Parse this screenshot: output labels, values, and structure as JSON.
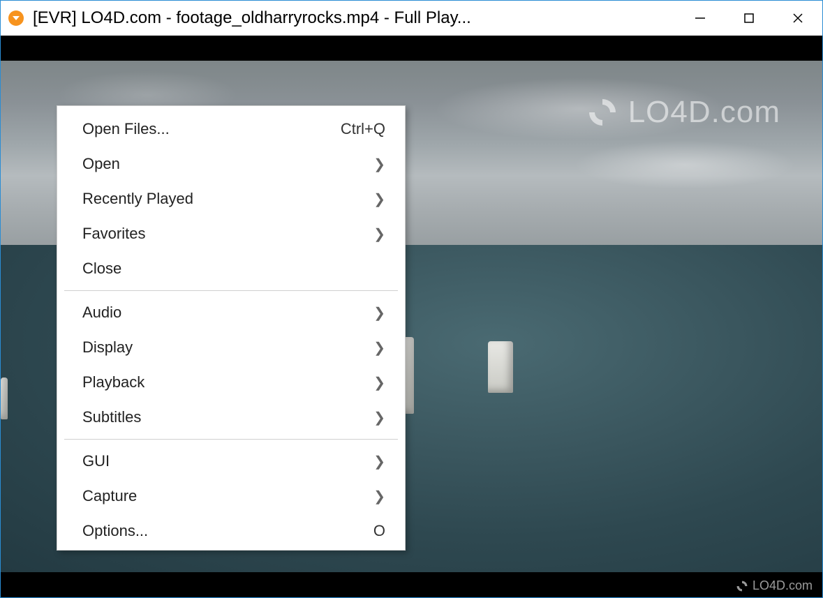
{
  "titlebar": {
    "title": "[EVR] LO4D.com - footage_oldharryrocks.mp4 - Full Play..."
  },
  "menu": {
    "items": [
      {
        "label": "Open Files...",
        "shortcut": "Ctrl+Q",
        "submenu": false
      },
      {
        "label": "Open",
        "shortcut": "",
        "submenu": true
      },
      {
        "label": "Recently Played",
        "shortcut": "",
        "submenu": true
      },
      {
        "label": "Favorites",
        "shortcut": "",
        "submenu": true
      },
      {
        "label": "Close",
        "shortcut": "",
        "submenu": false
      },
      "sep",
      {
        "label": "Audio",
        "shortcut": "",
        "submenu": true
      },
      {
        "label": "Display",
        "shortcut": "",
        "submenu": true
      },
      {
        "label": "Playback",
        "shortcut": "",
        "submenu": true
      },
      {
        "label": "Subtitles",
        "shortcut": "",
        "submenu": true
      },
      "sep",
      {
        "label": "GUI",
        "shortcut": "",
        "submenu": true
      },
      {
        "label": "Capture",
        "shortcut": "",
        "submenu": true
      },
      {
        "label": "Options...",
        "shortcut": "O",
        "submenu": false
      }
    ]
  },
  "watermark": {
    "text_big": "LO4D.com",
    "text_small": "LO4D.com",
    "text_mid": "LO4D.com"
  }
}
